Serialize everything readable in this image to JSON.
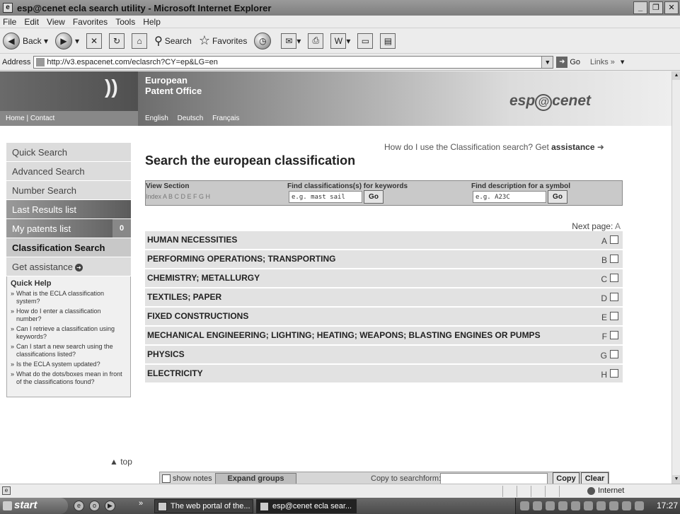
{
  "window": {
    "title": "esp@cenet ecla search utility - Microsoft Internet Explorer",
    "menu": [
      "File",
      "Edit",
      "View",
      "Favorites",
      "Tools",
      "Help"
    ],
    "toolbar": {
      "back": "Back",
      "search": "Search",
      "favorites": "Favorites"
    },
    "address_label": "Address",
    "url": "http://v3.espacenet.com/eclasrch?CY=ep&LG=en",
    "go_label": "Go",
    "links_label": "Links"
  },
  "banner": {
    "org_line1": "European",
    "org_line2": "Patent Office",
    "brand_prefix": "esp",
    "brand_at": "@",
    "brand_suffix": "cenet",
    "home_contact": "Home | Contact",
    "languages": [
      "English",
      "Deutsch",
      "Français"
    ]
  },
  "nav": {
    "items": [
      {
        "label": "Quick Search"
      },
      {
        "label": "Advanced Search"
      },
      {
        "label": "Number Search"
      },
      {
        "label": "Last Results list"
      },
      {
        "label": "My patents list",
        "count": "0"
      },
      {
        "label": "Classification Search"
      },
      {
        "label": "Get assistance"
      }
    ],
    "quick_help_title": "Quick Help",
    "quick_help": [
      "What is the ECLA classification system?",
      "How do I enter a classification number?",
      "Can I retrieve a classification using keywords?",
      "Can I start a new search using the classifications listed?",
      "Is the ECLA system updated?",
      "What do the dots/boxes mean in front of the classifications found?"
    ],
    "top_link": "▲ top"
  },
  "main": {
    "howto_text": "How do I use the Classification search? Get",
    "howto_link": "assistance",
    "title": "Search the european classification",
    "view_section_label": "View Section",
    "view_section_index": "Index A B C D E F G H",
    "keywords_label": "Find classifications(s) for keywords",
    "keywords_placeholder": "e.g. mast sail",
    "symbol_label": "Find description for a symbol",
    "symbol_placeholder": "e.g. A23C",
    "go_label": "Go",
    "next_page_label": "Next page:",
    "next_page_value": "A",
    "classes": [
      {
        "name": "HUMAN NECESSITIES",
        "letter": "A"
      },
      {
        "name": "PERFORMING OPERATIONS; TRANSPORTING",
        "letter": "B"
      },
      {
        "name": "CHEMISTRY; METALLURGY",
        "letter": "C"
      },
      {
        "name": "TEXTILES; PAPER",
        "letter": "D"
      },
      {
        "name": "FIXED CONSTRUCTIONS",
        "letter": "E"
      },
      {
        "name": "MECHANICAL ENGINEERING; LIGHTING; HEATING; WEAPONS; BLASTING ENGINES OR PUMPS",
        "letter": "F"
      },
      {
        "name": "PHYSICS",
        "letter": "G"
      },
      {
        "name": "ELECTRICITY",
        "letter": "H"
      }
    ],
    "show_notes": "show notes",
    "expand_groups": "Expand groups",
    "copy_to_label": "Copy to searchform:",
    "copy_button": "Copy",
    "clear_button": "Clear"
  },
  "status": {
    "zone": "Internet"
  },
  "taskbar": {
    "start": "start",
    "tasks": [
      "The web portal of the...",
      "esp@cenet ecla sear..."
    ],
    "clock": "17:27"
  }
}
